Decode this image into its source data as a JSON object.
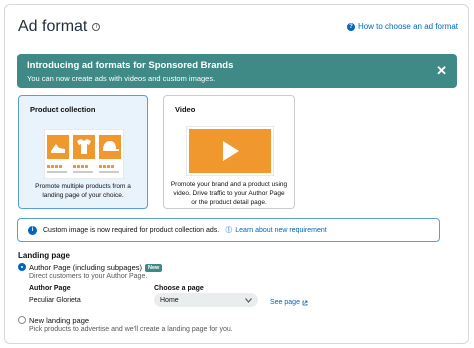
{
  "header": {
    "title": "Ad format",
    "help_link": "How to choose an ad format"
  },
  "banner": {
    "title": "Introducing ad formats for Sponsored Brands",
    "subtitle": "You can now create ads with videos and custom images.",
    "close": "✕"
  },
  "cards": [
    {
      "title": "Product collection",
      "description": "Promote multiple products from a landing page of your choice.",
      "selected": true
    },
    {
      "title": "Video",
      "description": "Promote your brand and a product using video. Drive traffic to your Author Page or the product detail page.",
      "selected": false
    }
  ],
  "notice": {
    "text": "Custom image is now required for product collection ads.",
    "link": "Learn about new requirement"
  },
  "landing": {
    "title": "Landing page",
    "author_option": {
      "label": "Author Page (including subpages)",
      "badge": "New",
      "desc": "Direct customers to your Author Page."
    },
    "author_label": "Author Page",
    "author_value": "Peculiar Glorieta",
    "choose_label": "Choose a page",
    "page_value": "Home",
    "see_page": "See page",
    "new_option": {
      "label": "New landing page",
      "desc": "Pick products to advertise and we'll create a landing page for you."
    }
  },
  "colors": {
    "banner": "#3f8a86",
    "accent": "#0066c0",
    "orange": "#f0972e"
  }
}
